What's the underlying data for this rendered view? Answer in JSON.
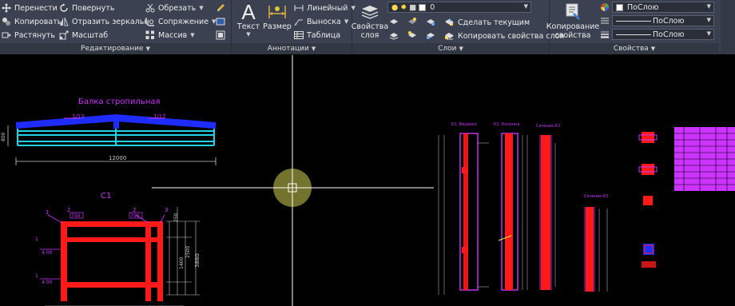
{
  "ribbon": {
    "edit": {
      "title": "Редактирование",
      "move": "Перенести",
      "rotate": "Повернуть",
      "trim": "Обрезать",
      "copy": "Копировать",
      "mirror": "Отразить зеркально",
      "fillet": "Сопряжение",
      "stretch": "Растянуть",
      "scale": "Масштаб",
      "array": "Массив"
    },
    "annotation": {
      "title": "Аннотации",
      "text": "Текст",
      "dimension": "Размер",
      "linear": "Линейный",
      "leader": "Выноска",
      "table": "Таблица"
    },
    "layers": {
      "title": "Слои",
      "layer_props_line1": "Свойства",
      "layer_props_line2": "слоя",
      "current_layer": "0",
      "make_current": "Сделать текущим",
      "match_layer": "Копировать свойства слоя"
    },
    "properties": {
      "title": "Свойства",
      "match_line1": "Копирование",
      "match_line2": "свойства",
      "color": "ПоСлою",
      "linetype": "ПоСлою",
      "lineweight": "ПоСлою"
    }
  },
  "drawing": {
    "beam_title": "Балка стропильная",
    "beam_length": "12000",
    "beam_left_dim": "1/12",
    "beam_right_dim": "1/12",
    "beam_height": "800",
    "frame_title": "С1",
    "frame_marks": [
      "1",
      "2",
      "2",
      "3"
    ],
    "frame_labels_top": [
      "750",
      "750"
    ],
    "frame_labels_left": [
      "1",
      "4.00",
      "1",
      "4.00"
    ],
    "frame_dims_right": [
      "250",
      "3880",
      "1400",
      "2500"
    ],
    "col_titles": [
      "К1. Вариант",
      "К1. Колонна",
      "Сечение К1",
      "Сечение К2"
    ]
  },
  "colors": {
    "ribbon_bg": "#3b4150",
    "canvas_bg": "#000000",
    "cursor_highlight": "#ffff66",
    "cad_blue": "#1e2cff",
    "cad_cyan": "#22d3e6",
    "cad_red": "#ff1a1a",
    "cad_magenta": "#cc33ff"
  }
}
